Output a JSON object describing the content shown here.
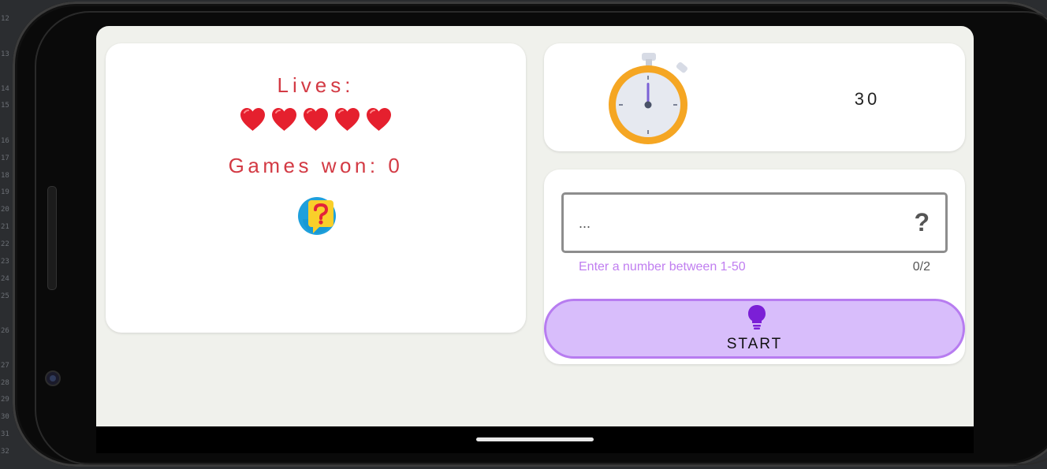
{
  "gutter_numbers": [
    "12",
    "13",
    "14",
    "15",
    "16",
    "17",
    "18",
    "19",
    "20",
    "21",
    "22",
    "23",
    "24",
    "25",
    "26",
    "27",
    "28",
    "29",
    "30",
    "31",
    "32"
  ],
  "lives_card": {
    "title": "Lives:",
    "hearts": 5,
    "games_won": "Games won: 0"
  },
  "timer_card": {
    "value": "30"
  },
  "input_card": {
    "field_value": "...",
    "trailing_icon": "?",
    "helper_text": "Enter a number between 1-50",
    "counter": "0/2"
  },
  "start_button": {
    "label": "START",
    "icon": "lightbulb-icon"
  },
  "icons": {
    "heart": "heart-icon",
    "help": "question-bubble-icon",
    "timer": "stopwatch-icon"
  },
  "colors": {
    "title_red": "#d33a44",
    "heart_red": "#e5202e",
    "button_fill": "#d8bdfb",
    "button_border": "#b77cf0",
    "helper_purple": "#c07ef0",
    "bulb_purple": "#7b1fd6",
    "screen_bg": "#f0f1ec"
  }
}
